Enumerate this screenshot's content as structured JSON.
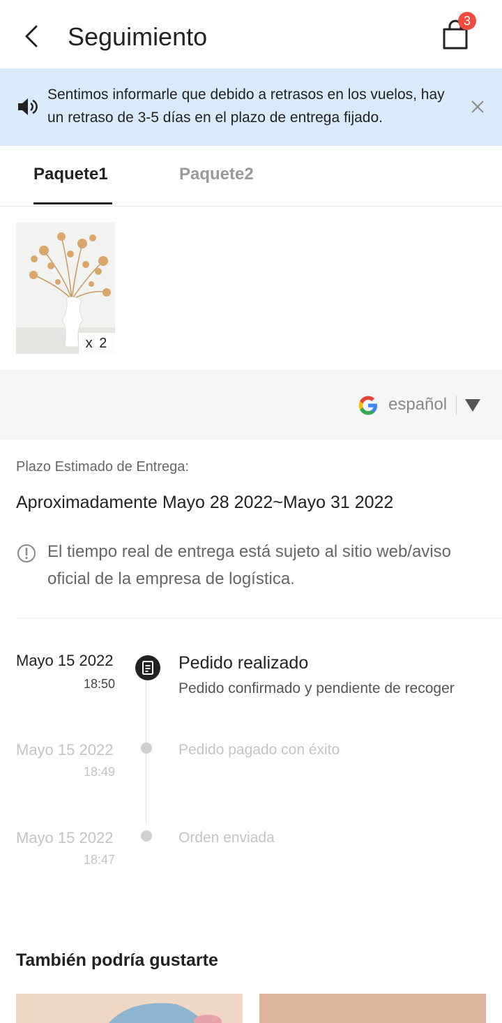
{
  "header": {
    "title": "Seguimiento",
    "cart_count": "3"
  },
  "notice": {
    "text": "Sentimos informarle que debido a retrasos en los vuelos, hay un retraso de 3-5 días en el plazo de entrega fijado."
  },
  "tabs": [
    {
      "label": "Paquete1",
      "active": true
    },
    {
      "label": "Paquete2",
      "active": false
    }
  ],
  "product": {
    "quantity_label": "x 2"
  },
  "translate": {
    "language": "español"
  },
  "delivery": {
    "label": "Plazo Estimado de Entrega:",
    "estimate": "Aproximadamente Mayo 28 2022~Mayo 31 2022",
    "note": "El tiempo real de entrega está sujeto al sitio web/aviso oficial de la empresa de logística."
  },
  "timeline": [
    {
      "date": "Mayo 15 2022",
      "time": "18:50",
      "title": "Pedido realizado",
      "description": "Pedido confirmado y pendiente de recoger",
      "active": true
    },
    {
      "date": "Mayo 15 2022",
      "time": "18:49",
      "title": "Pedido pagado con éxito",
      "active": false
    },
    {
      "date": "Mayo 15 2022",
      "time": "18:47",
      "title": "Orden enviada",
      "active": false
    }
  ],
  "recommendations": {
    "title": "También podría gustarte"
  },
  "colors": {
    "notice_bg": "#d9ebfb",
    "badge": "#f04b3c",
    "active_text": "#222222",
    "muted_text": "#c4c4c4"
  },
  "icons": {
    "back": "chevron-left-icon",
    "cart": "shopping-bag-icon",
    "speaker": "speaker-icon",
    "close": "close-icon",
    "google": "google-g-icon",
    "dropdown": "triangle-down-icon",
    "info": "info-circle-icon",
    "order": "document-icon"
  }
}
